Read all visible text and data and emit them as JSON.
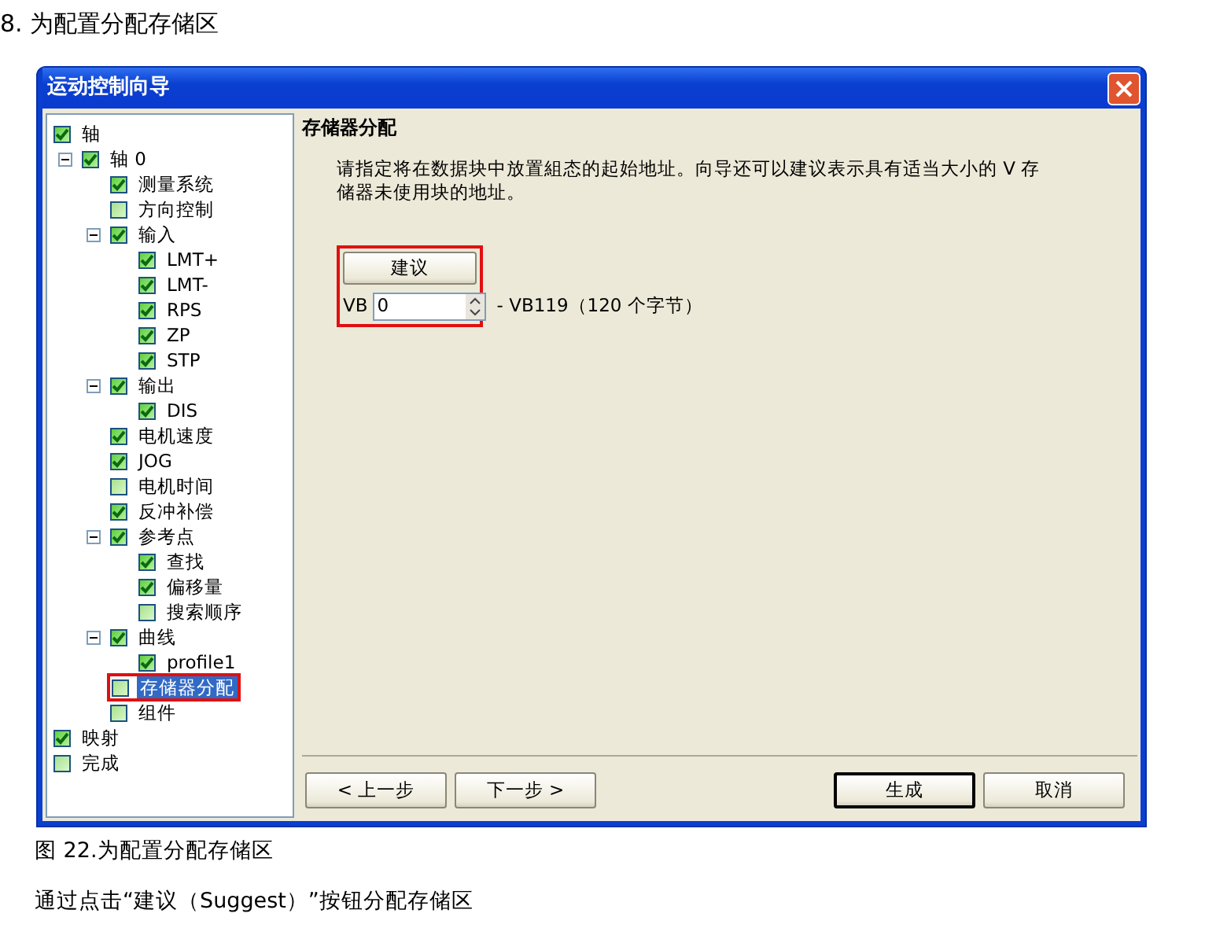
{
  "heading": "8. 为配置分配存储区",
  "dialog": {
    "title": "运动控制向导",
    "tree": [
      {
        "label": "轴",
        "checked": true,
        "selected": false,
        "marked": false,
        "children": [
          {
            "label": "轴 0",
            "checked": true,
            "selected": false,
            "marked": false,
            "expanded": true,
            "children": [
              {
                "label": "测量系统",
                "checked": true,
                "selected": false,
                "marked": false
              },
              {
                "label": "方向控制",
                "checked": false,
                "selected": false,
                "marked": false
              },
              {
                "label": "输入",
                "checked": true,
                "selected": false,
                "marked": false,
                "expanded": true,
                "children": [
                  {
                    "label": "LMT+",
                    "checked": true,
                    "selected": false,
                    "marked": false
                  },
                  {
                    "label": "LMT-",
                    "checked": true,
                    "selected": false,
                    "marked": false
                  },
                  {
                    "label": "RPS",
                    "checked": true,
                    "selected": false,
                    "marked": false
                  },
                  {
                    "label": "ZP",
                    "checked": true,
                    "selected": false,
                    "marked": false
                  },
                  {
                    "label": "STP",
                    "checked": true,
                    "selected": false,
                    "marked": false
                  }
                ]
              },
              {
                "label": "输出",
                "checked": true,
                "selected": false,
                "marked": false,
                "expanded": true,
                "children": [
                  {
                    "label": "DIS",
                    "checked": true,
                    "selected": false,
                    "marked": false
                  }
                ]
              },
              {
                "label": "电机速度",
                "checked": true,
                "selected": false,
                "marked": false
              },
              {
                "label": "JOG",
                "checked": true,
                "selected": false,
                "marked": false
              },
              {
                "label": "电机时间",
                "checked": false,
                "selected": false,
                "marked": false
              },
              {
                "label": "反冲补偿",
                "checked": true,
                "selected": false,
                "marked": false
              },
              {
                "label": "参考点",
                "checked": true,
                "selected": false,
                "marked": false,
                "expanded": true,
                "children": [
                  {
                    "label": "查找",
                    "checked": true,
                    "selected": false,
                    "marked": false
                  },
                  {
                    "label": "偏移量",
                    "checked": true,
                    "selected": false,
                    "marked": false
                  },
                  {
                    "label": "搜索顺序",
                    "checked": false,
                    "selected": false,
                    "marked": false
                  }
                ]
              },
              {
                "label": "曲线",
                "checked": true,
                "selected": false,
                "marked": false,
                "expanded": true,
                "children": [
                  {
                    "label": "profile1",
                    "checked": true,
                    "selected": false,
                    "marked": false
                  }
                ]
              },
              {
                "label": "存储器分配",
                "checked": false,
                "selected": true,
                "marked": true
              },
              {
                "label": "组件",
                "checked": false,
                "selected": false,
                "marked": false
              }
            ]
          }
        ]
      },
      {
        "label": "映射",
        "checked": true,
        "selected": false,
        "marked": false
      },
      {
        "label": "完成",
        "checked": false,
        "selected": false,
        "marked": false
      }
    ],
    "panel": {
      "title": "存储器分配",
      "description": "请指定将在数据块中放置組态的起始地址。向导还可以建议表示具有适当大小的 V 存储器未使用块的地址。",
      "suggest_button": "建议",
      "marked": true,
      "address": {
        "prefix": "VB",
        "value": "0",
        "range": "- VB119（120 个字节）"
      }
    },
    "buttons": [
      {
        "label": "< 上一步",
        "default": false
      },
      {
        "label": "下一步 >",
        "default": false
      },
      {
        "label": "生成",
        "default": true
      },
      {
        "label": "取消",
        "default": false
      }
    ]
  },
  "caption": "图 22.为配置分配存储区",
  "paragraph": "通过点击“建议（Suggest）”按钮分配存储区"
}
